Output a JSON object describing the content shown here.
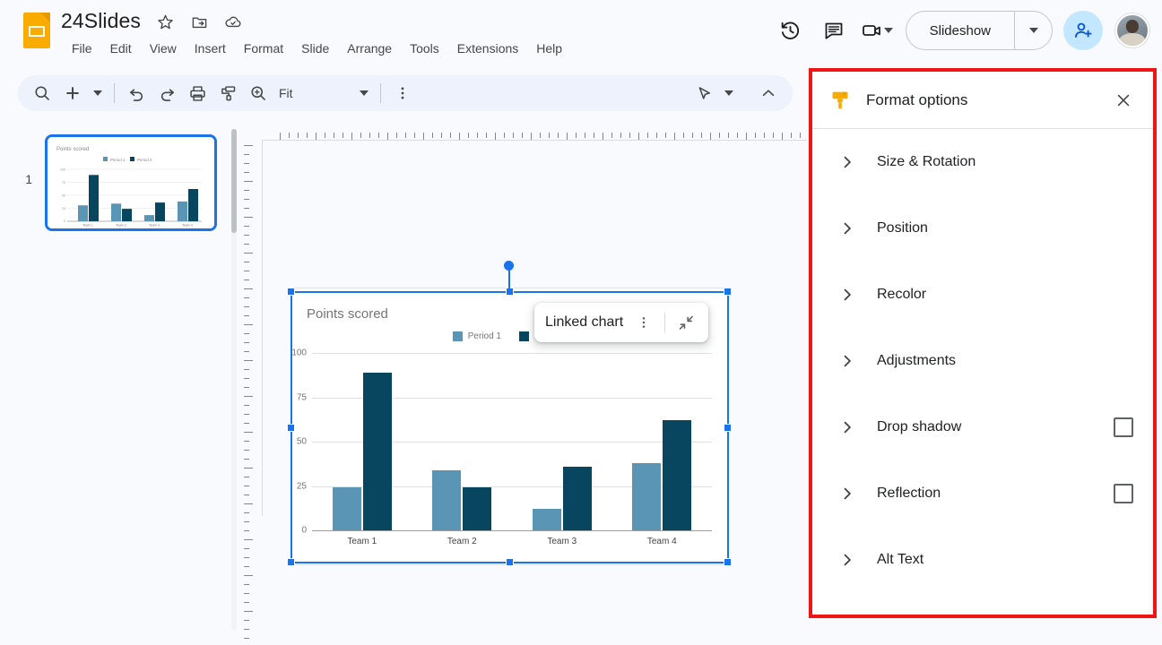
{
  "app": {
    "logo_icon": "slides-logo-icon",
    "doc_title": "24Slides",
    "title_icons": [
      "star-icon",
      "move-to-folder-icon",
      "cloud-saved-icon"
    ],
    "menus": [
      "File",
      "Edit",
      "View",
      "Insert",
      "Format",
      "Slide",
      "Arrange",
      "Tools",
      "Extensions",
      "Help"
    ]
  },
  "top_right": {
    "history_icon": "version-history-icon",
    "comment_icon": "comment-icon",
    "camera_icon": "present-video-icon",
    "camera_caret_icon": "chevron-down-icon",
    "slideshow_label": "Slideshow",
    "slideshow_caret_icon": "chevron-down-icon",
    "share_icon": "add-person-icon",
    "avatar_icon": "user-avatar"
  },
  "toolbar": {
    "search_icon": "search-icon",
    "add_icon": "new-slide-plus-icon",
    "add_caret_icon": "chevron-down-icon",
    "undo_icon": "undo-icon",
    "redo_icon": "redo-icon",
    "print_icon": "print-icon",
    "paint_format_icon": "paint-format-icon",
    "zoom_icon": "zoom-icon",
    "zoom_level": "Fit",
    "zoom_caret_icon": "chevron-down-icon",
    "more_icon": "more-vertical-icon",
    "cursor_icon": "select-cursor-icon",
    "cursor_caret_icon": "chevron-down-icon",
    "collapse_icon": "chevron-up-icon"
  },
  "filmstrip": {
    "slide_number": "1",
    "thumbnail_name": "slide-thumbnail-1"
  },
  "canvas": {
    "ruler_horizontal": "horizontal-ruler",
    "ruler_vertical": "vertical-ruler"
  },
  "linked_popup": {
    "label": "Linked chart",
    "more_icon": "more-vertical-icon",
    "collapse_icon": "collapse-diagonal-icon"
  },
  "format_panel": {
    "brush_icon": "paint-brush-icon",
    "title": "Format options",
    "close_icon": "close-icon",
    "rows": [
      {
        "label": "Size & Rotation",
        "chevron": "chevron-right-icon",
        "checkbox": false
      },
      {
        "label": "Position",
        "chevron": "chevron-right-icon",
        "checkbox": false
      },
      {
        "label": "Recolor",
        "chevron": "chevron-right-icon",
        "checkbox": false
      },
      {
        "label": "Adjustments",
        "chevron": "chevron-right-icon",
        "checkbox": false
      },
      {
        "label": "Drop shadow",
        "chevron": "chevron-right-icon",
        "checkbox": true
      },
      {
        "label": "Reflection",
        "chevron": "chevron-right-icon",
        "checkbox": true
      },
      {
        "label": "Alt Text",
        "chevron": "chevron-right-icon",
        "checkbox": false
      }
    ],
    "accent_color": "#f11414"
  },
  "chart_data": {
    "type": "bar",
    "title": "Points scored",
    "categories": [
      "Team 1",
      "Team 2",
      "Team 3",
      "Team 4"
    ],
    "series": [
      {
        "name": "Period 1",
        "color": "#5b95b5",
        "values": [
          24,
          34,
          12,
          38
        ]
      },
      {
        "name": "Period 2",
        "color": "#08455f",
        "values": [
          89,
          24,
          36,
          62
        ]
      }
    ],
    "xlabel": "",
    "ylabel": "",
    "ylim": [
      0,
      100
    ],
    "yticks": [
      0,
      25,
      50,
      75,
      100
    ],
    "grid": true,
    "legend_position": "top"
  }
}
